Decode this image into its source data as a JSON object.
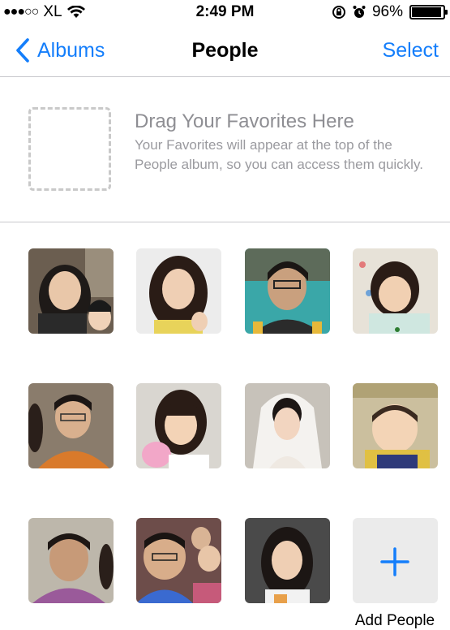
{
  "status_bar": {
    "carrier": "XL",
    "time": "2:49 PM",
    "battery": "96%",
    "battery_level": 0.96,
    "icons": [
      "signal-dots-icon",
      "wifi-icon",
      "rotation-lock-icon",
      "alarm-icon",
      "battery-icon"
    ]
  },
  "nav": {
    "back_label": "Albums",
    "title": "People",
    "select_label": "Select"
  },
  "favorites": {
    "title": "Drag Your Favorites Here",
    "description": "Your Favorites will appear at the top of the People album, so you can access them quickly."
  },
  "people_grid": {
    "add_label": "Add People",
    "accent_color": "#147efb"
  }
}
